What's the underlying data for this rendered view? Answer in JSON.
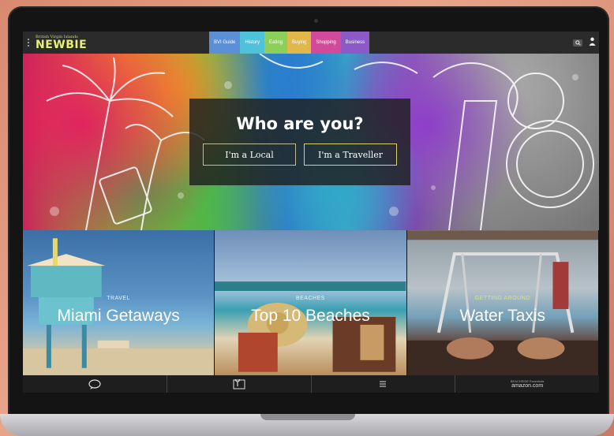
{
  "brand": {
    "subtitle": "British Virgin Islands",
    "name": "NEWBIE"
  },
  "nav": {
    "tabs": [
      {
        "label": "BVI Guide",
        "color": "#5b8fd6"
      },
      {
        "label": "History",
        "color": "#4fc1d9"
      },
      {
        "label": "Eating",
        "color": "#8ccf5b"
      },
      {
        "label": "Buying",
        "color": "#e0b84a"
      },
      {
        "label": "Shopping",
        "color": "#d14b9a"
      },
      {
        "label": "Business",
        "color": "#8b5ac7"
      }
    ]
  },
  "hero": {
    "title": "Who are you?",
    "local_label": "I'm a Local",
    "traveller_label": "I'm a Traveller"
  },
  "tiles": [
    {
      "category": "TRAVEL",
      "title": "Miami Getaways"
    },
    {
      "category": "BEACHES",
      "title": "Top 10 Beaches"
    },
    {
      "category": "GETTING AROUND",
      "title": "Water Taxis"
    }
  ],
  "bottom": {
    "amazon_small": "BEACHSIDE Essentials",
    "amazon_label": "amazon.com"
  }
}
